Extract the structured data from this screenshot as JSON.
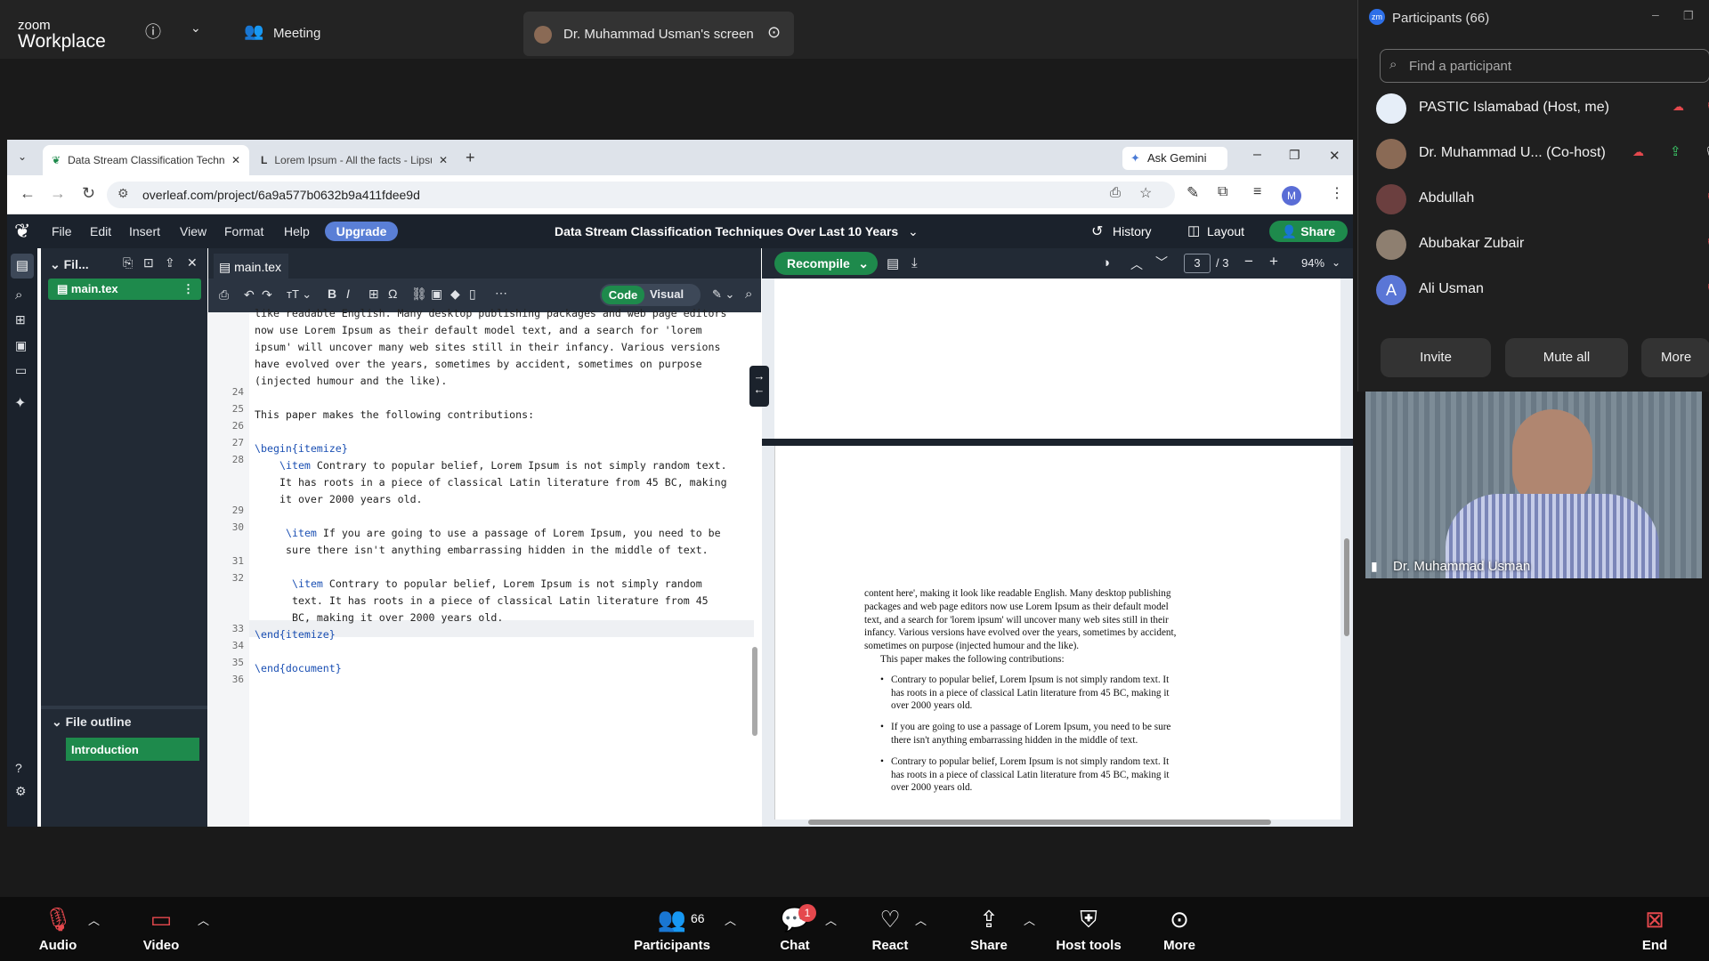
{
  "zoom": {
    "brand_top": "zoom",
    "brand_bottom": "Workplace",
    "meeting_label": "Meeting",
    "screen_label": "Dr. Muhammad Usman's screen"
  },
  "browser": {
    "tab1": "Data Stream Classification Techniques",
    "tab2": "Lorem Ipsum - All the facts - Lipsum",
    "ask_gemini": "Ask Gemini",
    "url": "overleaf.com/project/6a9a577b0632b9a411fdee9d",
    "profile": "M"
  },
  "overleaf": {
    "menus": [
      "File",
      "Edit",
      "Insert",
      "View",
      "Format",
      "Help"
    ],
    "upgrade": "Upgrade",
    "title": "Data Stream Classification Techniques Over Last 10 Years",
    "history": "History",
    "layout": "Layout",
    "share": "Share",
    "filetree": {
      "header": "Fil...",
      "file": "main.tex",
      "outline_header": "File outline",
      "outline_item": "Introduction"
    },
    "editor": {
      "tab": "main.tex",
      "code": "Code",
      "visual": "Visual"
    },
    "pdf": {
      "recompile": "Recompile",
      "page": "3",
      "page_total": "/ 3",
      "zoom": "94%"
    }
  },
  "code": {
    "l0a": "like readable English. Many desktop publishing packages and web page editors",
    "l0b": "now use Lorem Ipsum as their default model text, and a search for 'lorem",
    "l0c": "ipsum' will uncover many web sites still in their infancy. Various versions",
    "l0d": "have evolved over the years, sometimes by accident, sometimes on purpose",
    "l0e": "(injected humour and the like).",
    "l25": "This paper makes the following contributions:",
    "l27a": "\\begin",
    "l27b": "{itemize}",
    "l28a": "\\item",
    "l28b": " Contrary to popular belief, Lorem Ipsum is not simply random text.",
    "l28c": "It has roots in a piece of classical Latin literature from 45 BC, making",
    "l28d": "it over 2000 years old.",
    "l30a": "\\item",
    "l30b": " If you are going to use a passage of Lorem Ipsum, you need to be",
    "l30c": "sure there isn't anything embarrassing hidden in the middle of text.",
    "l32a": "\\item",
    "l32b": " Contrary to popular belief, Lorem Ipsum is not simply random",
    "l32c": "text. It has roots in a piece of classical Latin literature from 45",
    "l32d": "BC, making it over 2000 years old.",
    "l33a": "\\end",
    "l33b": "{itemize}",
    "l35a": "\\end",
    "l35b": "{document}",
    "lines": [
      "24",
      "25",
      "26",
      "27",
      "28",
      "29",
      "30",
      "31",
      "32",
      "33",
      "34",
      "35",
      "36"
    ]
  },
  "pdftext": {
    "p1": "content here', making it look like readable English. Many desktop publishing",
    "p2": "packages and web page editors now use Lorem Ipsum as their default model",
    "p3": "text, and a search for 'lorem ipsum' will uncover many web sites still in their",
    "p4": "infancy. Various versions have evolved over the years, sometimes by accident,",
    "p5": "sometimes on purpose (injected humour and the like).",
    "p6": "This paper makes the following contributions:",
    "b1a": "Contrary to popular belief, Lorem Ipsum is not simply random text. It",
    "b1b": "has roots in a piece of classical Latin literature from 45 BC, making it",
    "b1c": "over 2000 years old.",
    "b2a": "If you are going to use a passage of Lorem Ipsum, you need to be sure",
    "b2b": "there isn't anything embarrassing hidden in the middle of text.",
    "b3a": "Contrary to popular belief, Lorem Ipsum is not simply random text. It",
    "b3b": "has roots in a piece of classical Latin literature from 45 BC, making it",
    "b3c": "over 2000 years old."
  },
  "participants": {
    "title": "Participants (66)",
    "search_placeholder": "Find a participant",
    "list": [
      {
        "name": "PASTIC Islamabad (Host, me)"
      },
      {
        "name": "Dr. Muhammad U...  (Co-host)"
      },
      {
        "name": "Abdullah"
      },
      {
        "name": "Abubakar Zubair"
      },
      {
        "name": "Ali Usman",
        "initial": "A"
      }
    ],
    "invite": "Invite",
    "mute_all": "Mute all",
    "more": "More",
    "video_name": "Dr. Muhammad Usman"
  },
  "toolbar": {
    "audio": "Audio",
    "video": "Video",
    "participants": "Participants",
    "participants_count": "66",
    "chat": "Chat",
    "chat_badge": "1",
    "react": "React",
    "share": "Share",
    "host_tools": "Host tools",
    "more": "More",
    "end": "End"
  }
}
